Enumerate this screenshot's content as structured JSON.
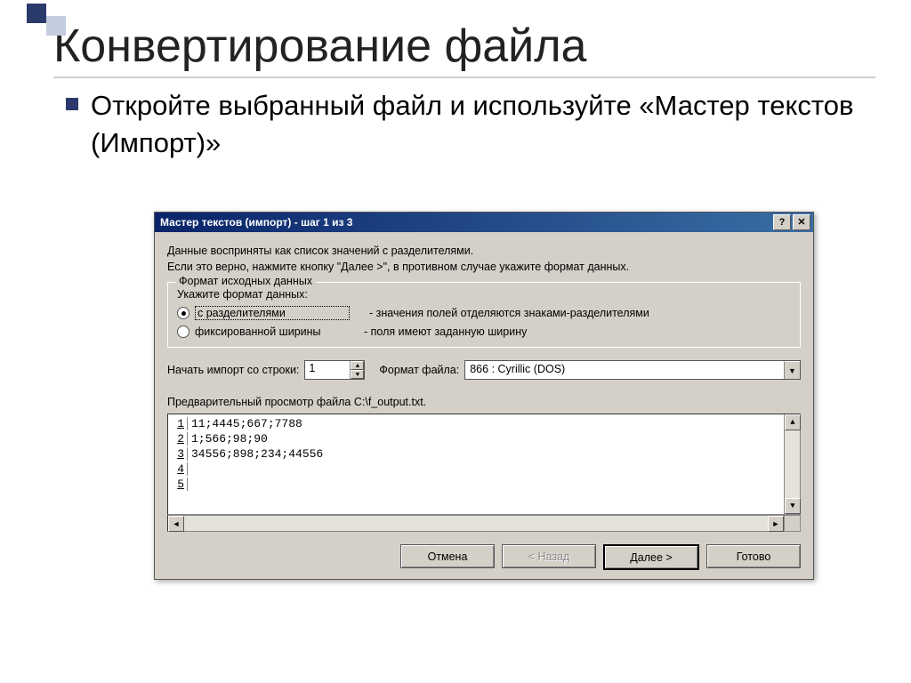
{
  "slide": {
    "title": "Конвертирование файла",
    "bullet": "Откройте выбранный файл и используйте «Мастер текстов (Импорт)»"
  },
  "dialog": {
    "title": "Мастер текстов (импорт) - шаг 1 из 3",
    "info1": "Данные восприняты как список значений с разделителями.",
    "info2": "Если это верно, нажмите кнопку \"Далее >\", в противном случае укажите формат данных.",
    "group_title": "Формат исходных данных",
    "group_prompt": "Укажите формат данных:",
    "radio_delim": "с разделителями",
    "radio_delim_desc": "- значения полей отделяются знаками-разделителями",
    "radio_fixed": "фиксированной ширины",
    "radio_fixed_desc": "- поля имеют заданную ширину",
    "start_row_label": "Начать импорт со строки:",
    "start_row_value": "1",
    "file_format_label": "Формат файла:",
    "file_format_value": "866 : Cyrillic (DOS)",
    "preview_label": "Предварительный просмотр файла C:\\f_output.txt.",
    "preview_rows": [
      "11;4445;667;7788",
      "1;566;98;90",
      "34556;898;234;44556",
      "",
      ""
    ],
    "buttons": {
      "cancel": "Отмена",
      "back": "< Назад",
      "next": "Далее >",
      "finish": "Готово"
    }
  }
}
